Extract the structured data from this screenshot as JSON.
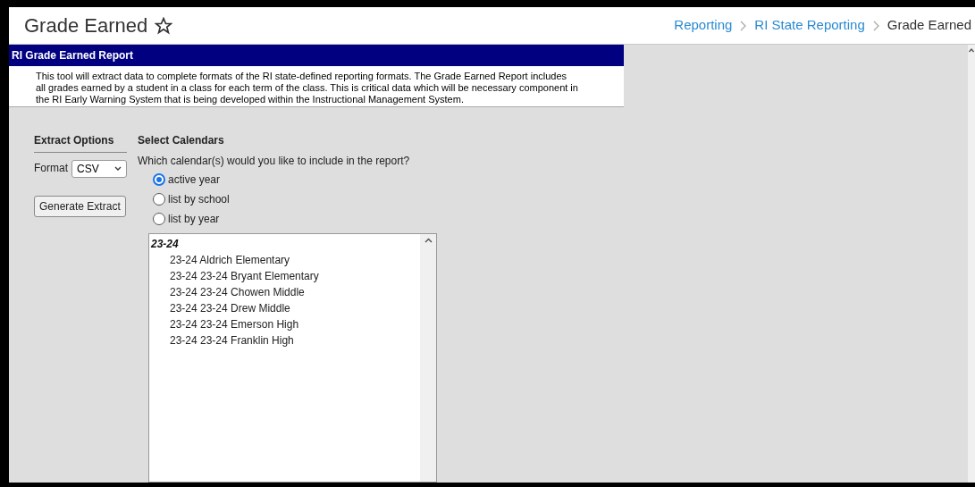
{
  "page_title": "Grade Earned",
  "breadcrumbs": [
    {
      "label": "Reporting",
      "kind": "link"
    },
    {
      "label": "RI State Reporting",
      "kind": "link"
    },
    {
      "label": "Grade Earned",
      "kind": "current"
    }
  ],
  "report": {
    "title": "RI Grade Earned Report",
    "description": "This tool will extract data to complete formats of the RI state-defined reporting formats. The Grade Earned Report includes all grades earned by a student in a class for each term of the class. This is critical data which will be necessary component in the RI Early Warning System that is being developed within the Instructional Management System."
  },
  "extract_options": {
    "heading": "Extract Options",
    "format_label": "Format",
    "format_value": "CSV",
    "generate_button": "Generate Extract"
  },
  "calendars": {
    "heading": "Select Calendars",
    "question": "Which calendar(s) would you like to include in the report?",
    "options": [
      {
        "label": "active year",
        "selected": true
      },
      {
        "label": "list by school",
        "selected": false
      },
      {
        "label": "list by year",
        "selected": false
      }
    ],
    "groups": [
      {
        "label": "23-24",
        "items": [
          "23-24 Aldrich Elementary",
          "23-24 23-24 Bryant Elementary",
          "23-24 23-24 Chowen Middle",
          "23-24 23-24 Drew Middle",
          "23-24 23-24 Emerson High",
          "23-24 23-24 Franklin High"
        ]
      }
    ]
  }
}
